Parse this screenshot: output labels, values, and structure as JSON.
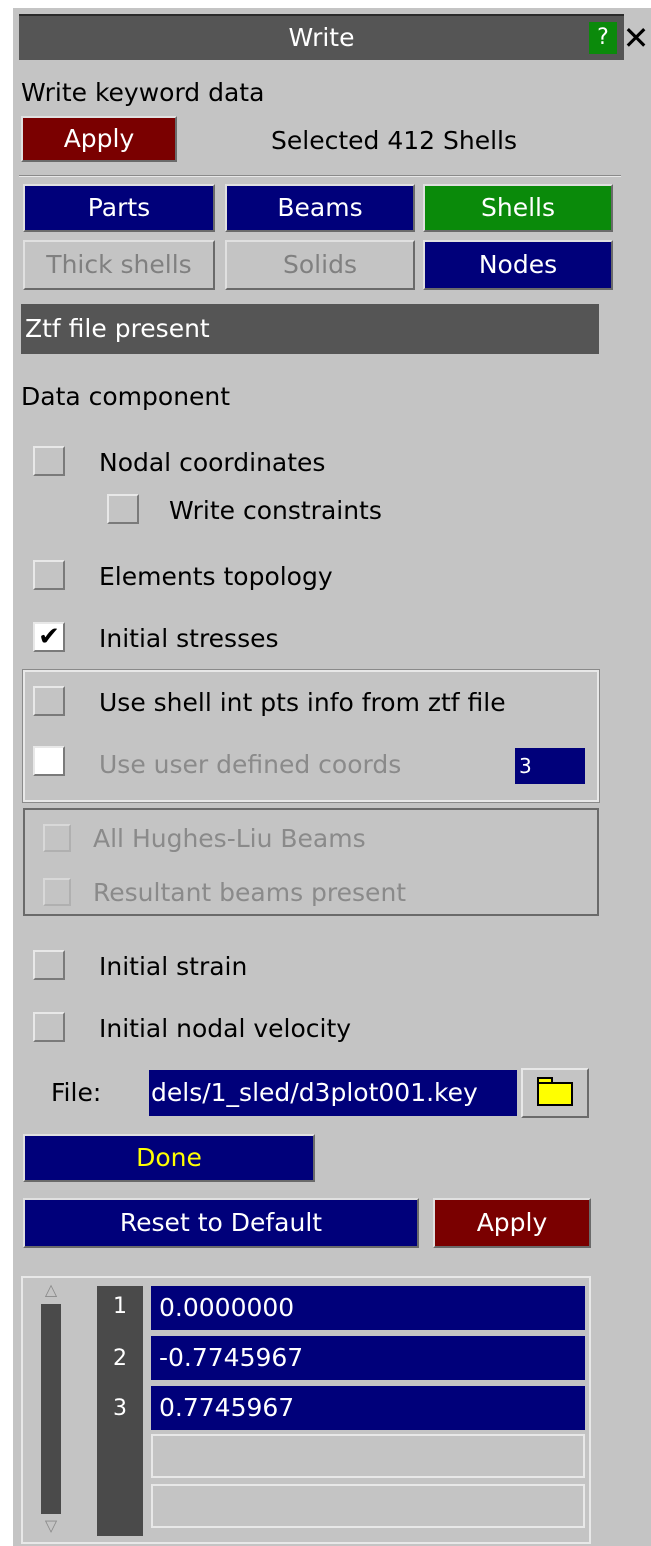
{
  "window": {
    "title": "Write",
    "help_label": "?",
    "close_label": "✕"
  },
  "header": {
    "subtitle": "Write keyword data",
    "apply_label": "Apply",
    "selection_status": "Selected 412 Shells"
  },
  "entity_tabs": {
    "parts": "Parts",
    "beams": "Beams",
    "shells": "Shells",
    "thick_shells": "Thick shells",
    "solids": "Solids",
    "nodes": "Nodes"
  },
  "ztf_status": "Ztf file present",
  "data_component": {
    "heading": "Data component",
    "nodal_coordinates": "Nodal coordinates",
    "write_constraints": "Write constraints",
    "elements_topology": "Elements topology",
    "initial_stresses": "Initial stresses",
    "initial_stresses_check": "✔",
    "use_shell_int_pts": "Use shell int pts info from ztf file",
    "use_user_defined_coords": "Use user defined coords",
    "user_coords_count": "3",
    "all_hughes_liu_beams": "All Hughes-Liu Beams",
    "resultant_beams_present": "Resultant beams present",
    "initial_strain": "Initial strain",
    "initial_nodal_velocity": "Initial nodal velocity"
  },
  "file": {
    "label": "File:",
    "value": "dels/1_sled/d3plot001.key"
  },
  "actions": {
    "done": "Done",
    "reset": "Reset to Default",
    "apply": "Apply"
  },
  "coords_list": {
    "scroll_up": "△",
    "scroll_down": "▽",
    "rows": [
      {
        "num": "1",
        "value": "0.0000000"
      },
      {
        "num": "2",
        "value": "-0.7745967"
      },
      {
        "num": "3",
        "value": "0.7745967"
      }
    ]
  },
  "colors": {
    "panel_bg": "#c4c4c4",
    "title_bg": "#555555",
    "blue_button": "#00007a",
    "green_button": "#0a8a0a",
    "red_button": "#7a0000",
    "done_text": "#ffff00"
  }
}
